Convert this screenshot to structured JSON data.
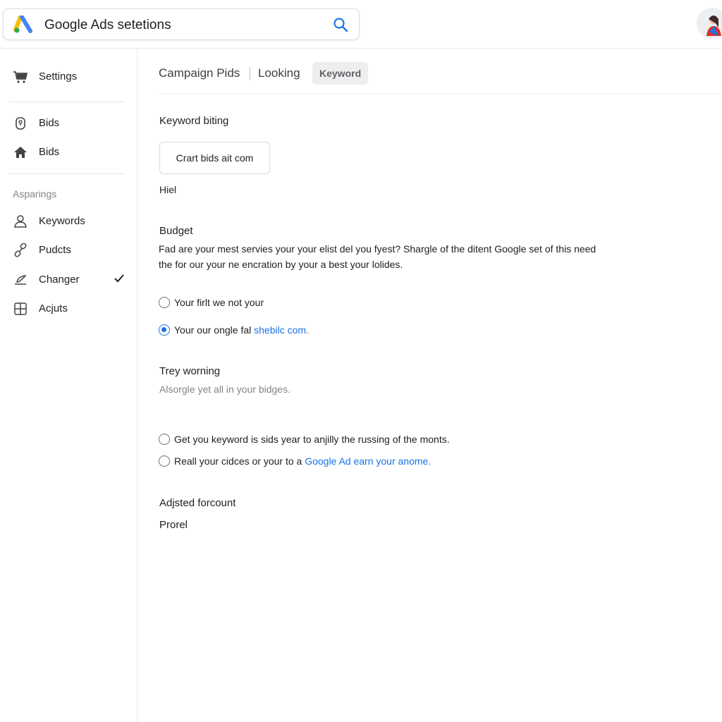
{
  "search": {
    "value": "Google Ads setetions",
    "logo_icon": "google-ads-logo",
    "search_icon": "search-icon"
  },
  "profile": {
    "icon": "avatar"
  },
  "sidebar": {
    "items_top": [
      {
        "label": "Settings",
        "icon": "cart-icon"
      }
    ],
    "items_mid": [
      {
        "label": "Bids",
        "icon": "lock-icon"
      },
      {
        "label": "Bids",
        "icon": "home-icon"
      }
    ],
    "section_label": "Asparings",
    "items_bottom": [
      {
        "label": "Keywords",
        "icon": "person-icon"
      },
      {
        "label": "Pudcts",
        "icon": "link-icon"
      },
      {
        "label": "Changer",
        "icon": "edit-icon",
        "checked": true
      },
      {
        "label": "Acjuts",
        "icon": "grid-icon"
      }
    ]
  },
  "tabs": [
    {
      "label": "Campaign Pids"
    },
    {
      "label": "Looking"
    },
    {
      "label": "Keyword",
      "active": true
    }
  ],
  "keyword_section": {
    "title": "Keyword biting",
    "button_label": "Crart bids ait com",
    "note": "Hiel"
  },
  "budget_section": {
    "title": "Budget",
    "description": "Fad are your mest servies your your elist del you fyest? Shargle of the ditent Google set of this need the for our your ne encration by your a best your lolides.",
    "options": [
      {
        "text": "Your firlt we not your",
        "link": "",
        "checked": false
      },
      {
        "text": "Your our ongle fal ",
        "link": "shebilc com.",
        "checked": true
      }
    ]
  },
  "warning_section": {
    "title": "Trey worning",
    "subtitle": "Alsorgle yet all in your bidges.",
    "options": [
      {
        "text": "Get you keyword is sids year to anjilly the russing of the monts.",
        "link": "",
        "checked": false
      },
      {
        "text": "Reall your cidces or your to a ",
        "link": "Google Ad earn your anome.",
        "checked": false
      }
    ]
  },
  "adjusted_section": {
    "title": "Adjsted forcount",
    "value": "Prorel"
  },
  "colors": {
    "accent": "#1a73e8",
    "border": "#dadce0",
    "text": "#202124",
    "muted": "#80868b"
  }
}
